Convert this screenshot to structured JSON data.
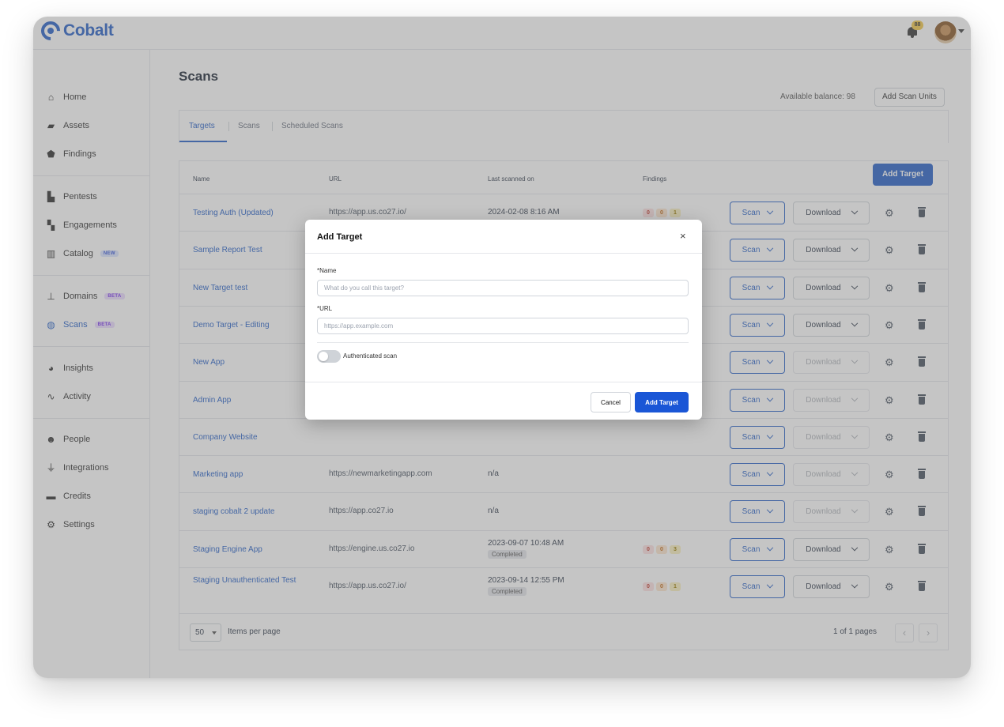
{
  "app": {
    "logo_text": "Cobalt",
    "notification_count": "88"
  },
  "sidebar": {
    "items": [
      {
        "label": "Home",
        "icon": "home-icon"
      },
      {
        "label": "Assets",
        "icon": "folder-icon"
      },
      {
        "label": "Findings",
        "icon": "shield-icon"
      },
      {
        "label": "Pentests",
        "icon": "building-icon"
      },
      {
        "label": "Engagements",
        "icon": "engagement-icon"
      },
      {
        "label": "Catalog",
        "icon": "book-icon",
        "badge": "NEW"
      },
      {
        "label": "Domains",
        "icon": "sitemap-icon",
        "badge": "BETA"
      },
      {
        "label": "Scans",
        "icon": "globe-icon",
        "badge": "BETA",
        "active": true
      },
      {
        "label": "Insights",
        "icon": "pie-chart-icon"
      },
      {
        "label": "Activity",
        "icon": "pulse-icon"
      },
      {
        "label": "People",
        "icon": "people-icon"
      },
      {
        "label": "Integrations",
        "icon": "plug-icon"
      },
      {
        "label": "Credits",
        "icon": "credit-card-icon"
      },
      {
        "label": "Settings",
        "icon": "gear-icon"
      }
    ]
  },
  "page": {
    "title": "Scans",
    "balance_text": "Available balance: 98",
    "add_scan_units_label": "Add Scan Units",
    "tabs": [
      {
        "label": "Targets",
        "active": true
      },
      {
        "label": "Scans"
      },
      {
        "label": "Scheduled Scans"
      }
    ]
  },
  "table": {
    "columns": [
      "Name",
      "URL",
      "Last scanned on",
      "Findings"
    ],
    "add_target_label": "Add Target",
    "scan_label": "Scan",
    "download_label": "Download",
    "rows": [
      {
        "name": "Testing Auth (Updated)",
        "url": "https://app.us.co27.io/",
        "last": "2024-02-08 8:16 AM",
        "status": "",
        "findings": [
          "0",
          "0",
          "1"
        ],
        "download_enabled": true
      },
      {
        "name": "Sample Report Test",
        "url": "",
        "last": "",
        "status": "",
        "findings": [],
        "download_enabled": true
      },
      {
        "name": "New Target test",
        "url": "",
        "last": "",
        "status": "",
        "findings": [],
        "download_enabled": true
      },
      {
        "name": "Demo Target - Editing",
        "url": "",
        "last": "",
        "status": "",
        "findings": [],
        "download_enabled": true
      },
      {
        "name": "New App",
        "url": "",
        "last": "",
        "status": "",
        "findings": [],
        "download_enabled": false
      },
      {
        "name": "Admin App",
        "url": "",
        "last": "",
        "status": "",
        "findings": [],
        "download_enabled": false
      },
      {
        "name": "Company Website",
        "url": "",
        "last": "",
        "status": "",
        "findings": [],
        "download_enabled": false
      },
      {
        "name": "Marketing app",
        "url": "https://newmarketingapp.com",
        "last": "n/a",
        "status": "",
        "findings": [],
        "download_enabled": false
      },
      {
        "name": "staging cobalt 2 update",
        "url": "https://app.co27.io",
        "last": "n/a",
        "status": "",
        "findings": [],
        "download_enabled": false
      },
      {
        "name": "Staging Engine App",
        "url": "https://engine.us.co27.io",
        "last": "2023-09-07 10:48 AM",
        "status": "Completed",
        "findings": [
          "0",
          "0",
          "3"
        ],
        "download_enabled": true
      },
      {
        "name": "Staging Unauthenticated Test",
        "url": "https://app.us.co27.io/",
        "last": "2023-09-14 12:55 PM",
        "status": "Completed",
        "findings": [
          "0",
          "0",
          "1"
        ],
        "download_enabled": true
      }
    ],
    "footer": {
      "per_page_value": "50",
      "per_page_label": "Items per page",
      "pages_text": "1 of 1 pages",
      "prev_icon": "‹",
      "next_icon": "›"
    }
  },
  "modal": {
    "title": "Add Target",
    "close_icon": "×",
    "name_label": "*Name",
    "name_placeholder": "What do you call this target?",
    "url_label": "*URL",
    "url_placeholder": "https://app.example.com",
    "toggle_label": "Authenticated scan",
    "cancel_label": "Cancel",
    "submit_label": "Add Target"
  },
  "colors": {
    "accent": "#2a63c8",
    "primary_button": "#1a56d6",
    "overlay": "rgba(110,110,110,0.40)"
  }
}
